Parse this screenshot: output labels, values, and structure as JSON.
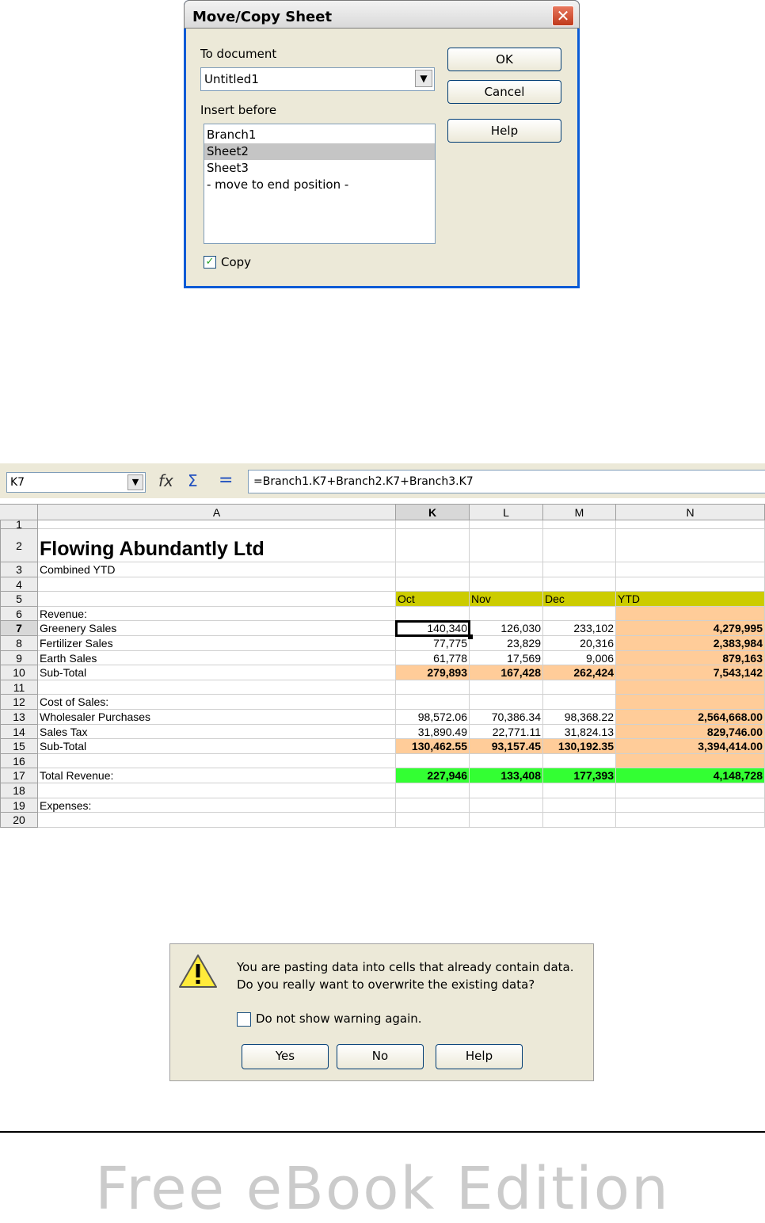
{
  "move_copy_dialog": {
    "title": "Move/Copy Sheet",
    "to_document_label": "To document",
    "to_document_value": "Untitled1",
    "insert_before_label": "Insert before",
    "sheets": [
      "Branch1",
      "Sheet2",
      "Sheet3",
      "- move to end position -"
    ],
    "selected_sheet": "Sheet2",
    "copy_label": "Copy",
    "copy_checked": true,
    "ok_label": "OK",
    "cancel_label": "Cancel",
    "help_label": "Help"
  },
  "spreadsheet": {
    "cell_reference": "K7",
    "formula": "=Branch1.K7+Branch2.K7+Branch3.K7",
    "columns": [
      "A",
      "K",
      "L",
      "M",
      "N"
    ],
    "active_column": "K",
    "active_row": "7",
    "rows": [
      {
        "row": "1",
        "A": "",
        "K": "",
        "L": "",
        "M": "",
        "N": ""
      },
      {
        "row": "2",
        "A": "Flowing Abundantly Ltd",
        "K": "",
        "L": "",
        "M": "",
        "N": ""
      },
      {
        "row": "3",
        "A": "Combined YTD",
        "K": "",
        "L": "",
        "M": "",
        "N": ""
      },
      {
        "row": "4",
        "A": "",
        "K": "",
        "L": "",
        "M": "",
        "N": ""
      },
      {
        "row": "5",
        "A": "",
        "K": "Oct",
        "L": "Nov",
        "M": "Dec",
        "N": "YTD"
      },
      {
        "row": "6",
        "A": "Revenue:",
        "K": "",
        "L": "",
        "M": "",
        "N": ""
      },
      {
        "row": "7",
        "A": "Greenery Sales",
        "K": "140,340",
        "L": "126,030",
        "M": "233,102",
        "N": "4,279,995"
      },
      {
        "row": "8",
        "A": "Fertilizer Sales",
        "K": "77,775",
        "L": "23,829",
        "M": "20,316",
        "N": "2,383,984"
      },
      {
        "row": "9",
        "A": "Earth Sales",
        "K": "61,778",
        "L": "17,569",
        "M": "9,006",
        "N": "879,163"
      },
      {
        "row": "10",
        "A": "Sub-Total",
        "K": "279,893",
        "L": "167,428",
        "M": "262,424",
        "N": "7,543,142"
      },
      {
        "row": "11",
        "A": "",
        "K": "",
        "L": "",
        "M": "",
        "N": ""
      },
      {
        "row": "12",
        "A": "Cost of Sales:",
        "K": "",
        "L": "",
        "M": "",
        "N": ""
      },
      {
        "row": "13",
        "A": "Wholesaler Purchases",
        "K": "98,572.06",
        "L": "70,386.34",
        "M": "98,368.22",
        "N": "2,564,668.00"
      },
      {
        "row": "14",
        "A": "Sales Tax",
        "K": "31,890.49",
        "L": "22,771.11",
        "M": "31,824.13",
        "N": "829,746.00"
      },
      {
        "row": "15",
        "A": "Sub-Total",
        "K": "130,462.55",
        "L": "93,157.45",
        "M": "130,192.35",
        "N": "3,394,414.00"
      },
      {
        "row": "16",
        "A": "",
        "K": "",
        "L": "",
        "M": "",
        "N": ""
      },
      {
        "row": "17",
        "A": "Total Revenue:",
        "K": "227,946",
        "L": "133,408",
        "M": "177,393",
        "N": "4,148,728"
      },
      {
        "row": "18",
        "A": "",
        "K": "",
        "L": "",
        "M": "",
        "N": ""
      },
      {
        "row": "19",
        "A": "Expenses:",
        "K": "",
        "L": "",
        "M": "",
        "N": ""
      },
      {
        "row": "20",
        "A": "",
        "K": "",
        "L": "",
        "M": "",
        "N": ""
      }
    ],
    "colors": {
      "header_fill": "#cccc00",
      "subtotal_fill": "#ffcc99",
      "total_fill": "#33ff33"
    }
  },
  "warning_dialog": {
    "message_line1": "You are pasting data into cells that already contain data.",
    "message_line2": "Do you really want to overwrite the existing data?",
    "checkbox_label": "Do not show warning again.",
    "checkbox_checked": false,
    "yes_label": "Yes",
    "no_label": "No",
    "help_label": "Help",
    "icon": "warning-icon"
  },
  "footer": {
    "watermark": "Free eBook Edition"
  }
}
